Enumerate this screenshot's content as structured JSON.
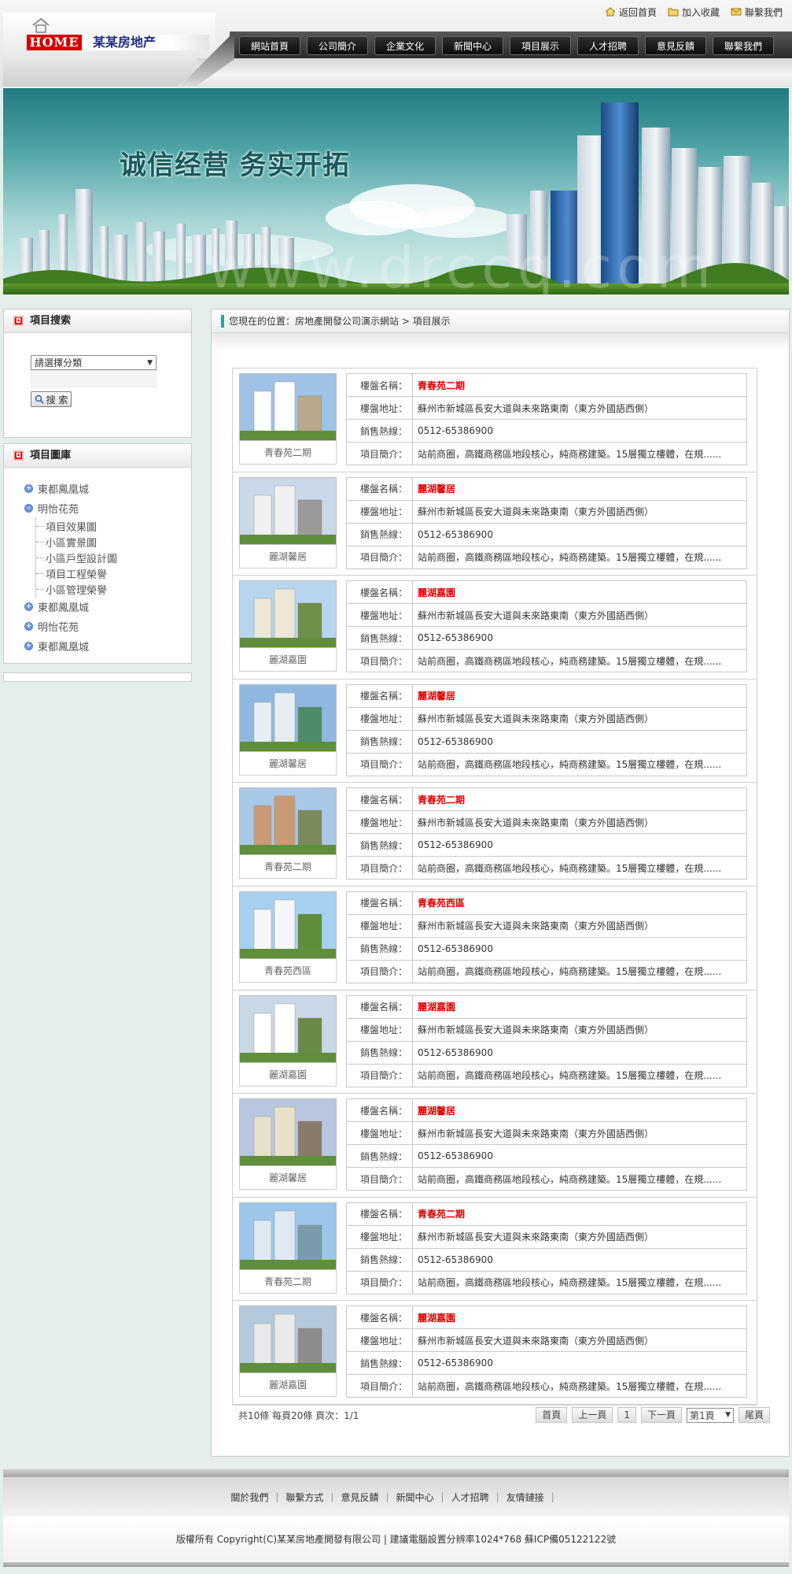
{
  "site": {
    "logo_home": "HOME",
    "logo_brand": "某某房地产"
  },
  "toplinks": [
    {
      "label": "返回首頁",
      "icon": "home-icon"
    },
    {
      "label": "加入收藏",
      "icon": "folder-icon"
    },
    {
      "label": "聯繫我們",
      "icon": "mail-icon"
    }
  ],
  "nav": [
    "網站首頁",
    "公司簡介",
    "企業文化",
    "新聞中心",
    "項目展示",
    "人才招聘",
    "意見反饋",
    "聯繫我們"
  ],
  "banner": {
    "slogan": "诚信经营 务实开拓",
    "watermark": "www.drccq.com"
  },
  "search_panel": {
    "title": "項目搜索",
    "select_value": "請選擇分類",
    "button_label": "搜 索"
  },
  "gallery_panel": {
    "title": "項目圖庫",
    "nodes": [
      {
        "label": "東都鳳凰城",
        "children": []
      },
      {
        "label": "明怡花苑",
        "children": [
          "項目效果圖",
          "小區實景圖",
          "小區戶型設計圖",
          "項目工程榮譽",
          "小區管理榮譽"
        ]
      },
      {
        "label": "東都鳳凰城",
        "children": []
      },
      {
        "label": "明怡花苑",
        "children": []
      },
      {
        "label": "東都鳳凰城",
        "children": []
      }
    ]
  },
  "breadcrumb": "您現在的位置：房地產開發公司演示網站 > 項目展示",
  "field_labels": {
    "name": "樓盤名稱：",
    "address": "樓盤地址：",
    "hotline": "銷售熱線：",
    "intro": "項目簡介："
  },
  "projects": [
    {
      "caption": "青春苑二期",
      "name": "青春苑二期",
      "address": "蘇州市新城區長安大道與未來路東南（東方外國語西側）",
      "hotline": "0512-65386900",
      "intro": "站前商圈，高鐵商務區地段核心，純商務建築。15層獨立樓體，在規......"
    },
    {
      "caption": "麗湖馨居",
      "name": "麗湖馨居",
      "address": "蘇州市新城區長安大道與未來路東南（東方外國語西側）",
      "hotline": "0512-65386900",
      "intro": "站前商圈，高鐵商務區地段核心，純商務建築。15層獨立樓體，在規......"
    },
    {
      "caption": "麗湖嘉園",
      "name": "麗湖嘉園",
      "address": "蘇州市新城區長安大道與未來路東南（東方外國語西側）",
      "hotline": "0512-65386900",
      "intro": "站前商圈，高鐵商務區地段核心，純商務建築。15層獨立樓體，在規......"
    },
    {
      "caption": "麗湖馨居",
      "name": "麗湖馨居",
      "address": "蘇州市新城區長安大道與未來路東南（東方外國語西側）",
      "hotline": "0512-65386900",
      "intro": "站前商圈，高鐵商務區地段核心，純商務建築。15層獨立樓體，在規......"
    },
    {
      "caption": "青春苑二期",
      "name": "青春苑二期",
      "address": "蘇州市新城區長安大道與未來路東南（東方外國語西側）",
      "hotline": "0512-65386900",
      "intro": "站前商圈，高鐵商務區地段核心，純商務建築。15層獨立樓體，在規......"
    },
    {
      "caption": "青春苑西區",
      "name": "青春苑西區",
      "address": "蘇州市新城區長安大道與未來路東南（東方外國語西側）",
      "hotline": "0512-65386900",
      "intro": "站前商圈，高鐵商務區地段核心，純商務建築。15層獨立樓體，在規......"
    },
    {
      "caption": "麗湖嘉園",
      "name": "麗湖嘉園",
      "address": "蘇州市新城區長安大道與未來路東南（東方外國語西側）",
      "hotline": "0512-65386900",
      "intro": "站前商圈，高鐵商務區地段核心，純商務建築。15層獨立樓體，在規......"
    },
    {
      "caption": "麗湖馨居",
      "name": "麗湖馨居",
      "address": "蘇州市新城區長安大道與未來路東南（東方外國語西側）",
      "hotline": "0512-65386900",
      "intro": "站前商圈，高鐵商務區地段核心，純商務建築。15層獨立樓體，在規......"
    },
    {
      "caption": "青春苑二期",
      "name": "青春苑二期",
      "address": "蘇州市新城區長安大道與未來路東南（東方外國語西側）",
      "hotline": "0512-65386900",
      "intro": "站前商圈，高鐵商務區地段核心，純商務建築。15層獨立樓體，在規......"
    },
    {
      "caption": "麗湖嘉園",
      "name": "麗湖嘉園",
      "address": "蘇州市新城區長安大道與未來路東南（東方外國語西側）",
      "hotline": "0512-65386900",
      "intro": "站前商圈，高鐵商務區地段核心，純商務建築。15層獨立樓體，在規......"
    }
  ],
  "pager": {
    "summary": "共10條 每頁20條 頁次：1/1",
    "first": "首頁",
    "prev": "上一頁",
    "current": "1",
    "next": "下一頁",
    "page_select": "第1頁",
    "last": "尾頁"
  },
  "footer": {
    "links": [
      "關於我們",
      "聯繫方式",
      "意見反饋",
      "新聞中心",
      "人才招聘",
      "友情鏈接"
    ],
    "copyright": "版權所有 Copyright(C)某某房地產開發有限公司 | 建議電腦設置分辨率1024*768 蘇ICP備05122122號"
  },
  "colors": {
    "accent_red": "#e00000",
    "nav_dark": "#1a1a1a",
    "banner_teal": "#3b9a9c",
    "crumb_bar": "#2aa1a8"
  }
}
